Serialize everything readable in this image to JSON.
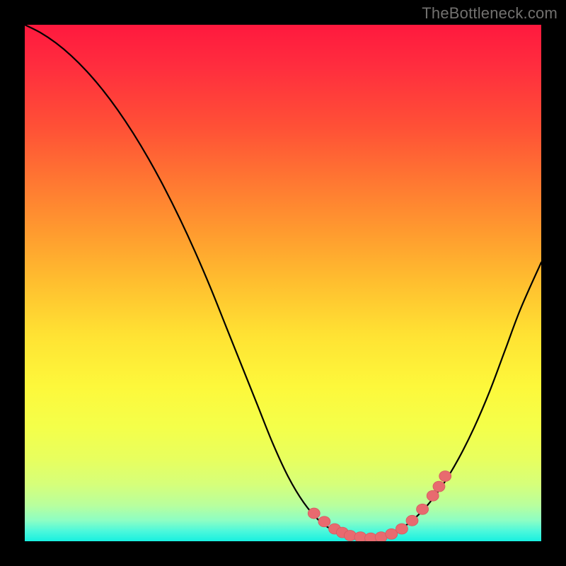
{
  "watermark": "TheBottleneck.com",
  "colors": {
    "marker_fill": "#e86a6f",
    "marker_stroke": "#d55a60",
    "curve_stroke": "#000000"
  },
  "chart_data": {
    "type": "line",
    "title": "",
    "xlabel": "",
    "ylabel": "",
    "xlim": [
      0,
      100
    ],
    "ylim": [
      0,
      100
    ],
    "grid": false,
    "series": [
      {
        "name": "bottleneck-curve",
        "x": [
          0,
          3,
          6,
          9,
          12,
          15,
          18,
          21,
          24,
          27,
          30,
          33,
          36,
          39,
          42,
          45,
          48,
          51,
          54,
          57,
          60,
          63,
          66,
          69,
          72,
          75,
          78,
          81,
          84,
          87,
          90,
          93,
          96,
          100
        ],
        "y": [
          100,
          98.5,
          96.5,
          94,
          91,
          87.5,
          83.5,
          79,
          74,
          68.5,
          62.5,
          56,
          49,
          41.5,
          34,
          26.5,
          19,
          12.5,
          7.5,
          4,
          2,
          1,
          0.5,
          1,
          2,
          4,
          7,
          11,
          16,
          22,
          29,
          37,
          45,
          54
        ]
      }
    ],
    "markers": {
      "name": "highlight-points",
      "x": [
        56,
        58,
        60,
        61.5,
        63,
        65,
        67,
        69,
        71,
        73,
        75,
        77,
        79,
        80.2,
        81.4
      ],
      "y": [
        5.4,
        3.8,
        2.4,
        1.7,
        1.1,
        0.8,
        0.6,
        0.8,
        1.4,
        2.4,
        4.0,
        6.2,
        8.8,
        10.6,
        12.6
      ]
    }
  }
}
